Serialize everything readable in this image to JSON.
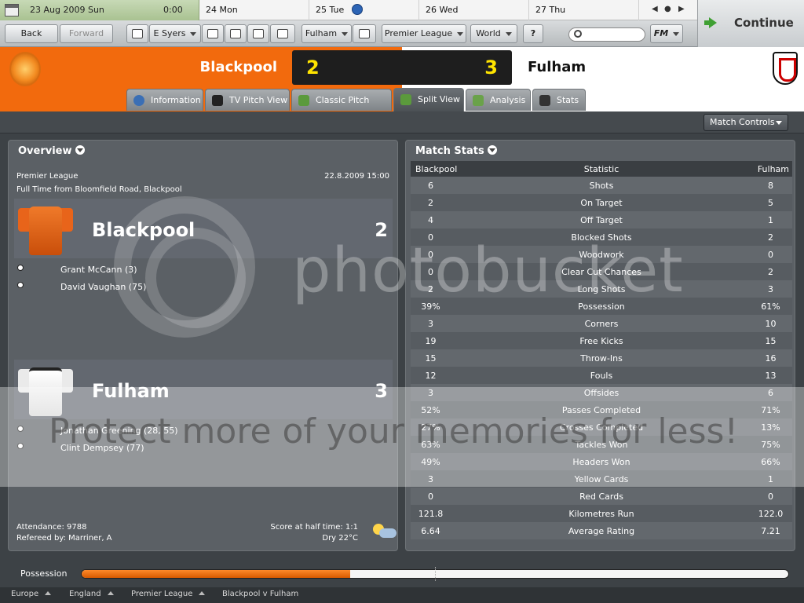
{
  "calendar": {
    "date": "23 Aug 2009  Sun",
    "time": "0:00",
    "days": [
      "24 Mon",
      "25 Tue",
      "26 Wed",
      "27 Thu"
    ]
  },
  "toolbar": {
    "back": "Back",
    "forward": "Forward",
    "manager": "E Syers",
    "club": "Fulham",
    "competition": "Premier League",
    "world": "World",
    "help": "?",
    "fm": "FM",
    "continue": "Continue"
  },
  "match": {
    "home_team": "Blackpool",
    "away_team": "Fulham",
    "home_score": "2",
    "away_score": "3"
  },
  "tabs": [
    "Information",
    "TV Pitch View",
    "Classic Pitch View",
    "Split View",
    "Analysis",
    "Stats"
  ],
  "active_tab": "Split View",
  "match_controls": "Match Controls",
  "overview": {
    "title": "Overview",
    "competition": "Premier League",
    "datetime": "22.8.2009 15:00",
    "venue": "Full Time from Bloomfield Road, Blackpool",
    "home": {
      "name": "Blackpool",
      "score": "2",
      "scorers": [
        "Grant McCann (3)",
        "David Vaughan (75)"
      ]
    },
    "away": {
      "name": "Fulham",
      "score": "3",
      "scorers": [
        "Jonathan Greening (28, 55)",
        "Clint Dempsey (77)"
      ]
    },
    "attendance": "Attendance: 9788",
    "referee": "Refereed by: Marriner, A",
    "half_time": "Score at half time: 1:1",
    "weather": "Dry 22°C"
  },
  "stats": {
    "title": "Match Stats",
    "columns": [
      "Blackpool",
      "Statistic",
      "Fulham"
    ],
    "rows": [
      [
        "6",
        "Shots",
        "8"
      ],
      [
        "2",
        "On Target",
        "5"
      ],
      [
        "4",
        "Off Target",
        "1"
      ],
      [
        "0",
        "Blocked Shots",
        "2"
      ],
      [
        "0",
        "Woodwork",
        "0"
      ],
      [
        "0",
        "Clear Cut Chances",
        "2"
      ],
      [
        "2",
        "Long Shots",
        "3"
      ],
      [
        "39%",
        "Possession",
        "61%"
      ],
      [
        "3",
        "Corners",
        "10"
      ],
      [
        "19",
        "Free Kicks",
        "15"
      ],
      [
        "15",
        "Throw-Ins",
        "16"
      ],
      [
        "12",
        "Fouls",
        "13"
      ],
      [
        "3",
        "Offsides",
        "6"
      ],
      [
        "52%",
        "Passes Completed",
        "71%"
      ],
      [
        "27%",
        "Crosses Completed",
        "13%"
      ],
      [
        "63%",
        "Tackles Won",
        "75%"
      ],
      [
        "49%",
        "Headers Won",
        "66%"
      ],
      [
        "3",
        "Yellow Cards",
        "1"
      ],
      [
        "0",
        "Red Cards",
        "0"
      ],
      [
        "121.8",
        "Kilometres Run",
        "122.0"
      ],
      [
        "6.64",
        "Average Rating",
        "7.21"
      ]
    ]
  },
  "possession": {
    "label": "Possession",
    "home_fraction": 0.38
  },
  "breadcrumbs": [
    "Europe",
    "England",
    "Premier League",
    "Blackpool v Fulham"
  ],
  "watermark": {
    "brand": "photobucket",
    "tagline": "Protect more of your memories for less!"
  },
  "colors": {
    "home": "#f26a0d",
    "away": "#ffffff",
    "score": "#ffe400"
  }
}
